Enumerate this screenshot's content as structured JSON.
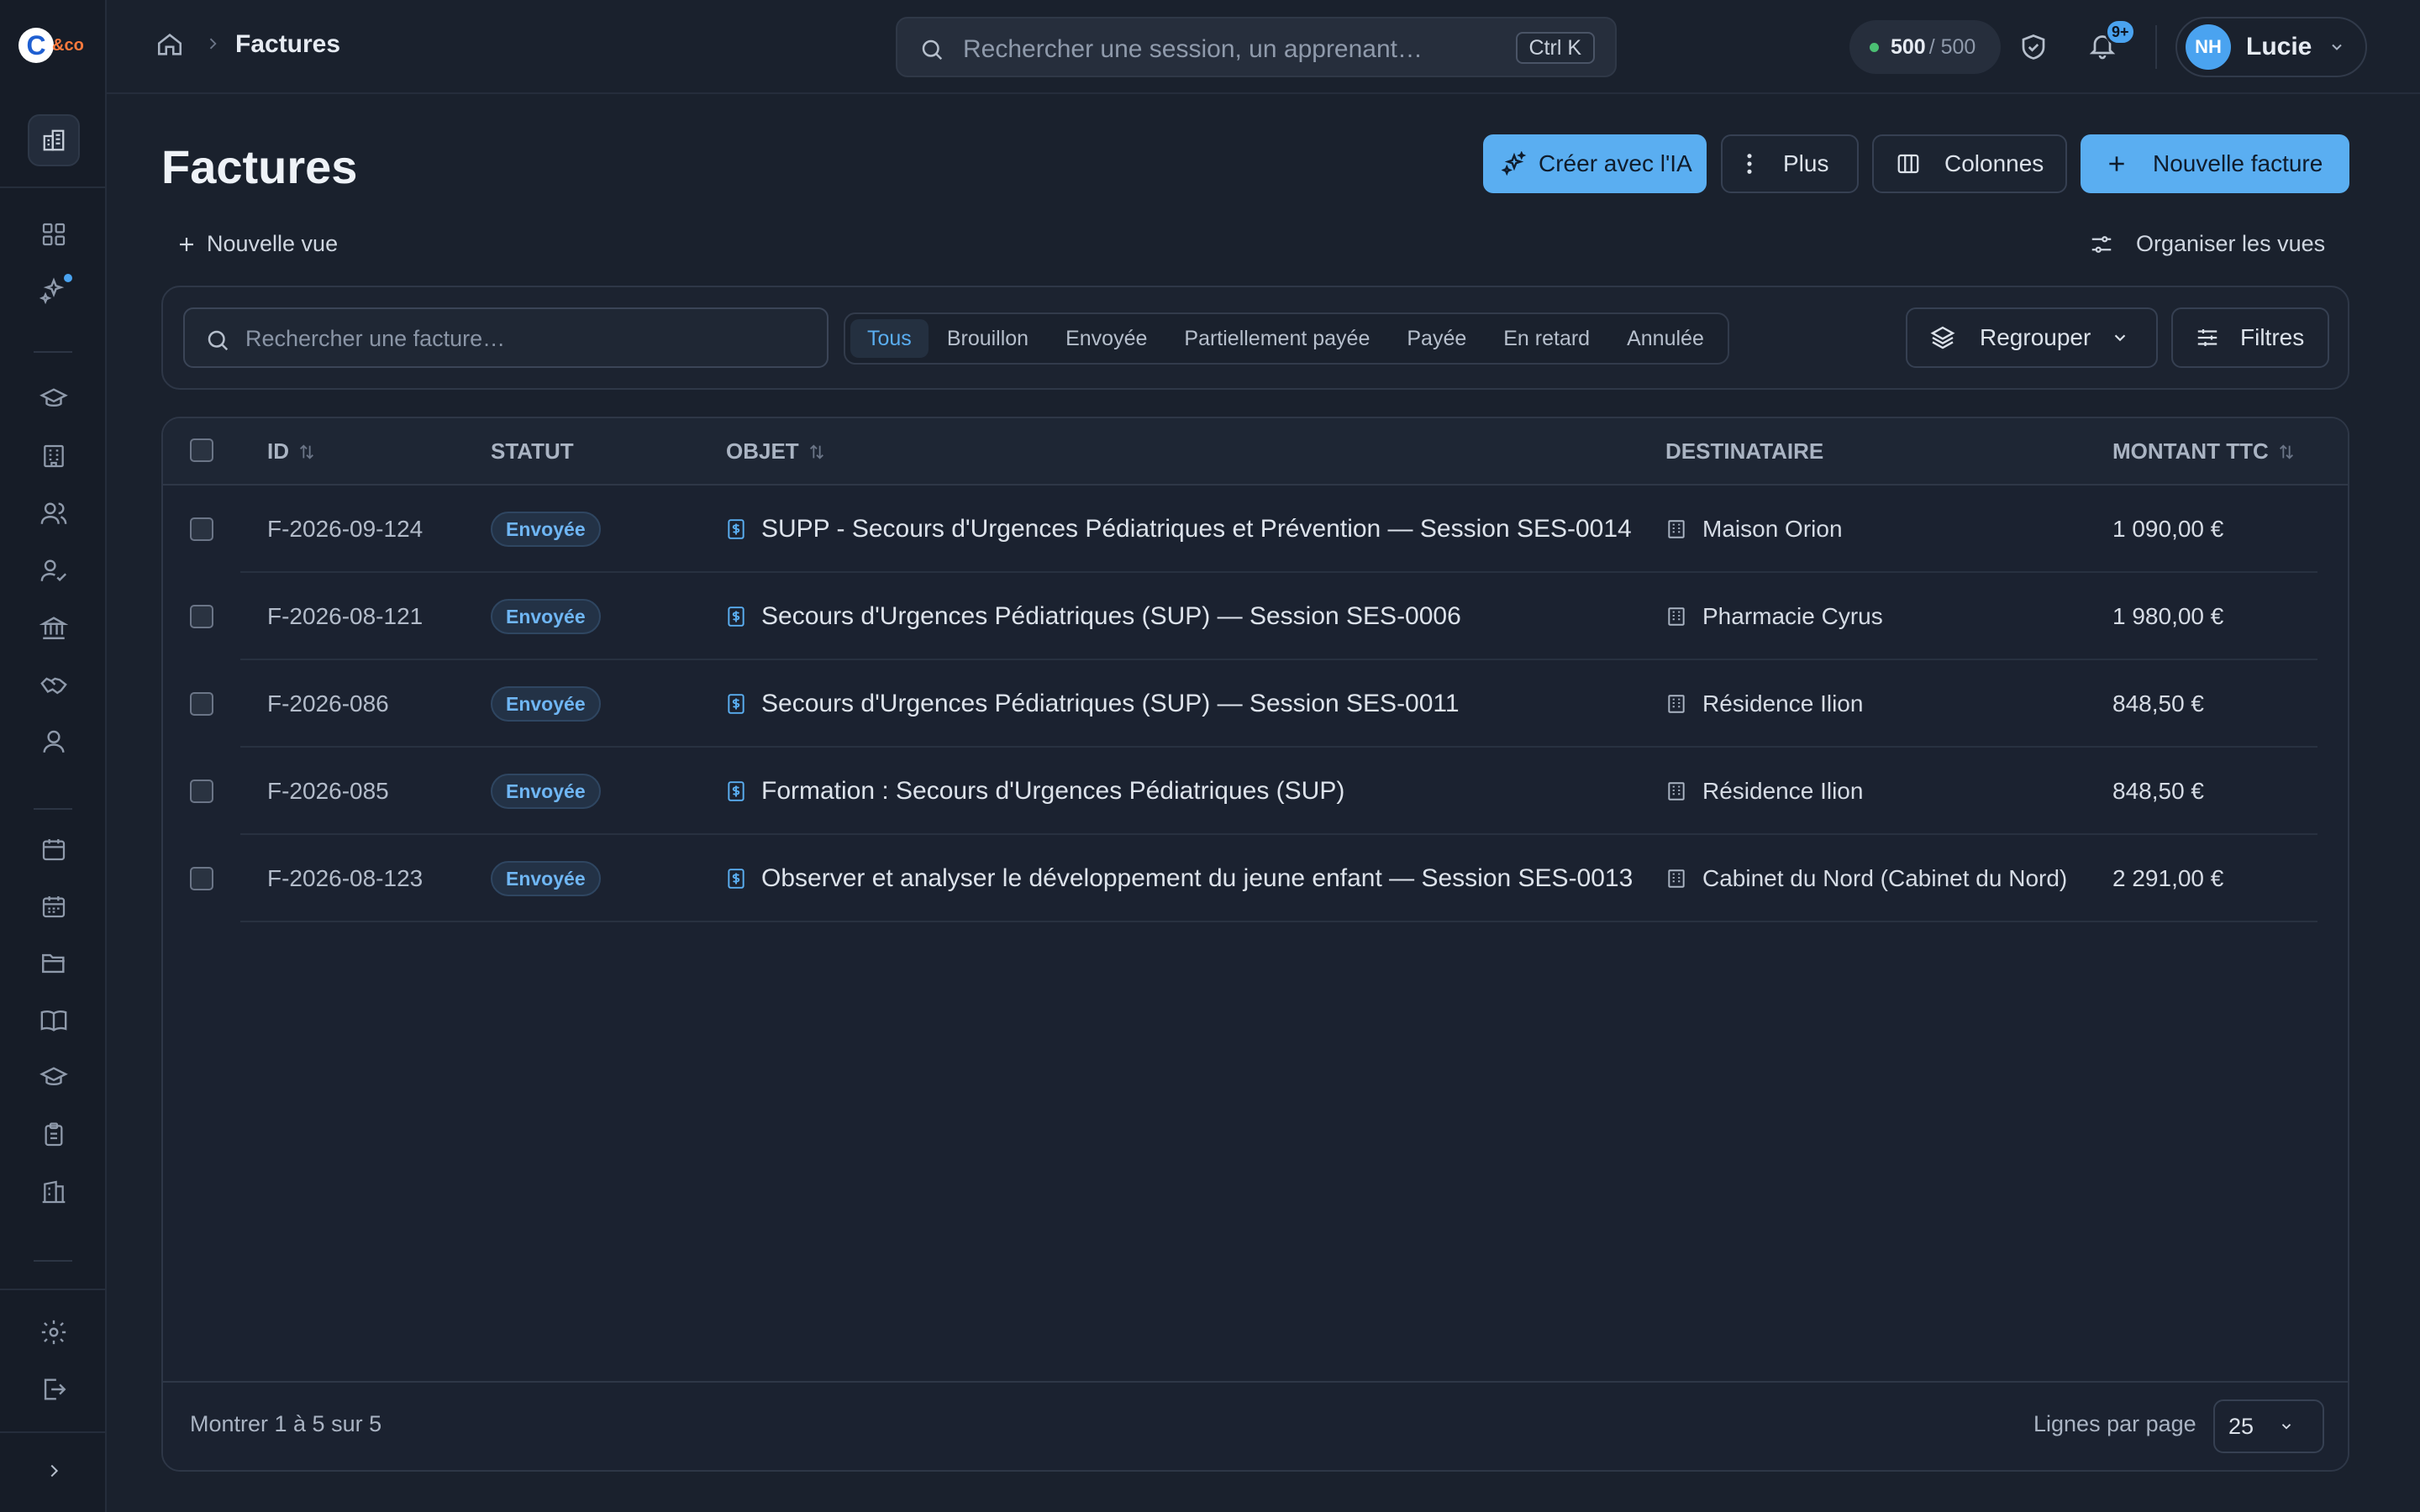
{
  "app": {
    "logo_mark": "C",
    "logo_text": "&co"
  },
  "breadcrumb": {
    "current": "Factures"
  },
  "global_search": {
    "placeholder": "Rechercher une session, un apprenant…",
    "shortcut": "Ctrl K"
  },
  "credits": {
    "used": "500",
    "total": "/ 500",
    "status_color": "#4bbf73"
  },
  "notifications": {
    "badge": "9+"
  },
  "user": {
    "initials": "NH",
    "name": "Lucie"
  },
  "page": {
    "title": "Factures"
  },
  "toolbar": {
    "ai_label": "Créer avec l'IA",
    "more_label": "Plus",
    "columns_label": "Colonnes",
    "new_label": "Nouvelle facture"
  },
  "views": {
    "new_view_label": "Nouvelle vue",
    "organize_label": "Organiser les vues"
  },
  "filters": {
    "search_placeholder": "Rechercher une facture…",
    "status_tabs": [
      "Tous",
      "Brouillon",
      "Envoyée",
      "Partiellement payée",
      "Payée",
      "En retard",
      "Annulée"
    ],
    "active_tab": "Tous",
    "group_label": "Regrouper",
    "filters_label": "Filtres"
  },
  "table": {
    "columns": [
      "ID",
      "STATUT",
      "OBJET",
      "DESTINATAIRE",
      "MONTANT TTC"
    ],
    "rows": [
      {
        "id": "F-2026-09-124",
        "status": "Envoyée",
        "object": "SUPP - Secours d'Urgences Pédiatriques et Prévention — Session SES-0014",
        "recipient": "Maison Orion",
        "amount": "1 090,00 €"
      },
      {
        "id": "F-2026-08-121",
        "status": "Envoyée",
        "object": "Secours d'Urgences Pédiatriques (SUP) — Session SES-0006",
        "recipient": "Pharmacie Cyrus",
        "amount": "1 980,00 €"
      },
      {
        "id": "F-2026-086",
        "status": "Envoyée",
        "object": "Secours d'Urgences Pédiatriques (SUP) — Session SES-0011",
        "recipient": "Résidence Ilion",
        "amount": "848,50 €"
      },
      {
        "id": "F-2026-085",
        "status": "Envoyée",
        "object": "Formation : Secours d'Urgences Pédiatriques (SUP)",
        "recipient": "Résidence Ilion",
        "amount": "848,50 €"
      },
      {
        "id": "F-2026-08-123",
        "status": "Envoyée",
        "object": "Observer et analyser le développement du jeune enfant — Session SES-0013",
        "recipient": "Cabinet du Nord (Cabinet du Nord)",
        "amount": "2 291,00 €"
      }
    ]
  },
  "pagination": {
    "showing": "Montrer 1 à 5 sur 5",
    "rows_per_page_label": "Lignes par page",
    "rows_per_page": "25"
  },
  "sidebar": {
    "icons": [
      "dashboard-icon",
      "ai-sparkle-icon",
      "graduation-icon",
      "building-icon",
      "users-icon",
      "user-check-icon",
      "institution-icon",
      "handshake-icon",
      "contacts-icon",
      "calendar-icon",
      "calendar-grid-icon",
      "folder-icon",
      "book-icon",
      "diploma-icon",
      "clipboard-icon",
      "office-icon",
      "settings-icon",
      "logout-icon",
      "expand-icon"
    ]
  },
  "colors": {
    "accent": "#5aaef1",
    "background": "#1a212d",
    "sidebar": "#161c27"
  }
}
